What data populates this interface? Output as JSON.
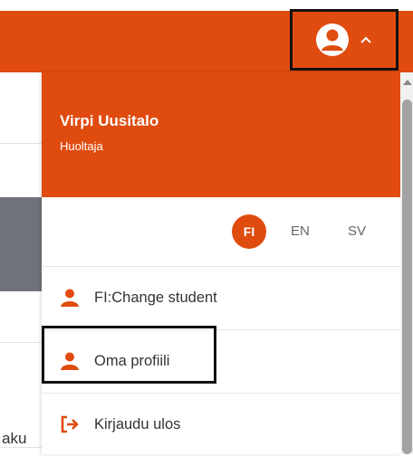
{
  "header": {
    "user_icon": "user-circle-icon",
    "toggle_icon": "chevron-up-icon"
  },
  "dropdown": {
    "user_name": "Virpi Uusitalo",
    "user_role": "Huoltaja",
    "languages": [
      {
        "code": "FI",
        "active": true
      },
      {
        "code": "EN",
        "active": false
      },
      {
        "code": "SV",
        "active": false
      }
    ],
    "menu": [
      {
        "label": "FI:Change student",
        "icon": "person-icon"
      },
      {
        "label": "Oma profiili",
        "icon": "person-icon"
      },
      {
        "label": "Kirjaudu ulos",
        "icon": "logout-icon"
      }
    ]
  },
  "background": {
    "partial_text": "aku"
  },
  "colors": {
    "accent": "#e04b0f",
    "highlight_border": "#111111"
  }
}
